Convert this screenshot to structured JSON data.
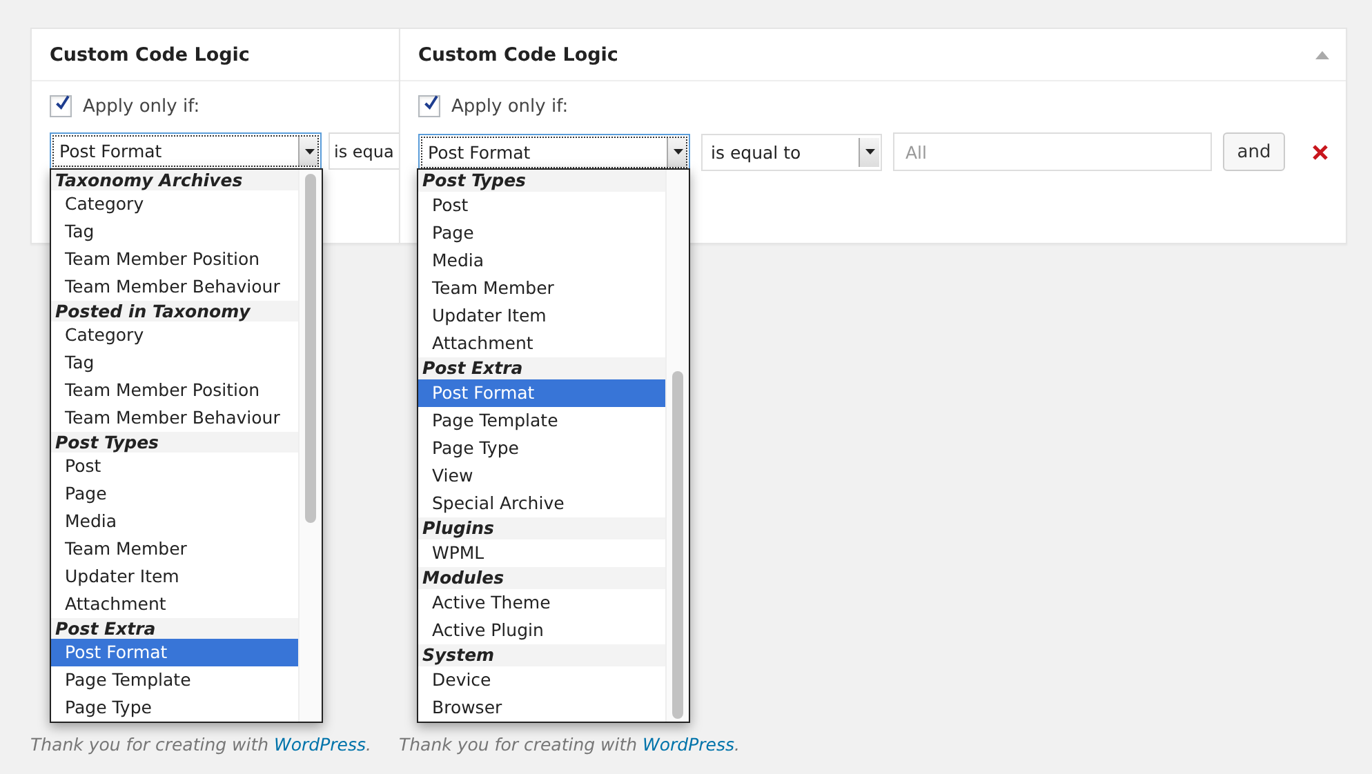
{
  "panels": [
    {
      "title": "Custom Code Logic",
      "apply_label": "Apply only if:",
      "apply_checked": true,
      "field_select": "Post Format",
      "operator_select": "is equa",
      "dropdown": {
        "groups": [
          {
            "label": "Taxonomy Archives",
            "options": [
              {
                "label": "Category",
                "selected": false
              },
              {
                "label": "Tag",
                "selected": false
              },
              {
                "label": "Team Member Position",
                "selected": false
              },
              {
                "label": "Team Member Behaviour",
                "selected": false
              }
            ]
          },
          {
            "label": "Posted in Taxonomy",
            "options": [
              {
                "label": "Category",
                "selected": false
              },
              {
                "label": "Tag",
                "selected": false
              },
              {
                "label": "Team Member Position",
                "selected": false
              },
              {
                "label": "Team Member Behaviour",
                "selected": false
              }
            ]
          },
          {
            "label": "Post Types",
            "options": [
              {
                "label": "Post",
                "selected": false
              },
              {
                "label": "Page",
                "selected": false
              },
              {
                "label": "Media",
                "selected": false
              },
              {
                "label": "Team Member",
                "selected": false
              },
              {
                "label": "Updater Item",
                "selected": false
              },
              {
                "label": "Attachment",
                "selected": false
              }
            ]
          },
          {
            "label": "Post Extra",
            "options": [
              {
                "label": "Post Format",
                "selected": true
              },
              {
                "label": "Page Template",
                "selected": false
              },
              {
                "label": "Page Type",
                "selected": false
              }
            ]
          }
        ]
      },
      "footer": {
        "text": "Thank you for creating with ",
        "link": "WordPress",
        "end": "."
      }
    },
    {
      "title": "Custom Code Logic",
      "collapse_toggle": true,
      "apply_label": "Apply only if:",
      "apply_checked": true,
      "field_select": "Post Format",
      "operator_select": "is equal to",
      "value_placeholder": "All",
      "and_button": "and",
      "remove_button": true,
      "dropdown": {
        "groups": [
          {
            "label": "Post Types",
            "options": [
              {
                "label": "Post",
                "selected": false
              },
              {
                "label": "Page",
                "selected": false
              },
              {
                "label": "Media",
                "selected": false
              },
              {
                "label": "Team Member",
                "selected": false
              },
              {
                "label": "Updater Item",
                "selected": false
              },
              {
                "label": "Attachment",
                "selected": false
              }
            ]
          },
          {
            "label": "Post Extra",
            "options": [
              {
                "label": "Post Format",
                "selected": true
              },
              {
                "label": "Page Template",
                "selected": false
              },
              {
                "label": "Page Type",
                "selected": false
              },
              {
                "label": "View",
                "selected": false
              },
              {
                "label": "Special Archive",
                "selected": false
              }
            ]
          },
          {
            "label": "Plugins",
            "options": [
              {
                "label": "WPML",
                "selected": false
              }
            ]
          },
          {
            "label": "Modules",
            "options": [
              {
                "label": "Active Theme",
                "selected": false
              },
              {
                "label": "Active Plugin",
                "selected": false
              }
            ]
          },
          {
            "label": "System",
            "options": [
              {
                "label": "Device",
                "selected": false
              },
              {
                "label": "Browser",
                "selected": false
              }
            ]
          }
        ]
      },
      "footer": {
        "text": "Thank you for creating with ",
        "link": "WordPress",
        "end": "."
      }
    }
  ]
}
